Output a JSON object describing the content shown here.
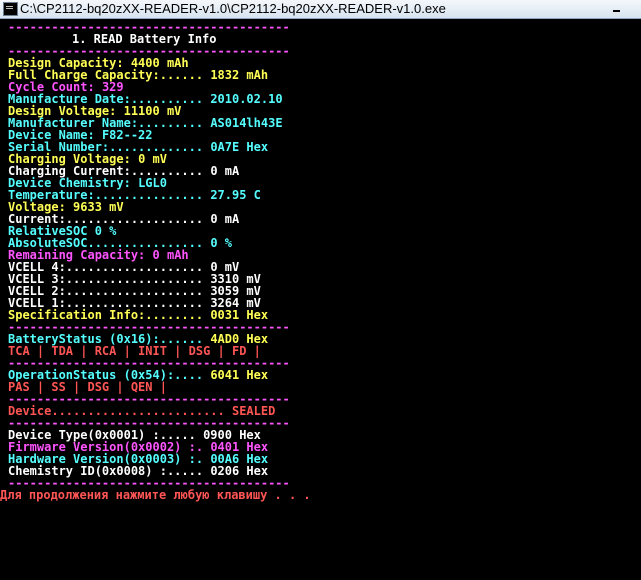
{
  "window": {
    "title": "C:\\CP2112-bq20zXX-READER-v1.0\\CP2112-bq20zXX-READER-v1.0.exe"
  },
  "colors": {
    "white": "#ffffff",
    "yellow": "#ffff55",
    "cyan": "#55ffff",
    "magenta": "#ff55ff",
    "red": "#ff5555",
    "background": "#000000"
  },
  "header": {
    "rule": "---------------------------------------",
    "title": "1. READ Battery Info"
  },
  "fields": [
    {
      "label": "Design Capacity:",
      "value": "4400 mAh",
      "color": "yellow"
    },
    {
      "label": "Full Charge Capacity:......",
      "value": "1832 mAh",
      "color": "yellow"
    },
    {
      "label": "Cycle Count:",
      "value": "329",
      "color": "magenta"
    },
    {
      "label": "Manufacture Date:..........",
      "value": "2010.02.10",
      "color": "cyan"
    },
    {
      "label": "Design Voltage:",
      "value": "11100 mV",
      "color": "yellow"
    },
    {
      "label": "Manufacturer Name:.........",
      "value": "AS014lh43E",
      "color": "cyan"
    },
    {
      "label": "Device Name:",
      "value": "F82--22",
      "color": "cyan"
    },
    {
      "label": "Serial Number:.............",
      "value": "0A7E Hex",
      "color": "cyan"
    },
    {
      "label": "Charging Voltage:",
      "value": "0 mV",
      "color": "yellow"
    },
    {
      "label": "Charging Current:..........",
      "value": "0 mA",
      "color": "white"
    },
    {
      "label": "Device Chemistry:",
      "value": "LGL0",
      "color": "cyan"
    },
    {
      "label": "Temperature:...............",
      "value": "27.95 C",
      "color": "cyan"
    },
    {
      "label": "Voltage:",
      "value": "9633 mV",
      "color": "yellow"
    },
    {
      "label": "Current:...................",
      "value": "0 mA",
      "color": "white"
    },
    {
      "label": "RelativeSOC",
      "value": "0 %",
      "color": "cyan"
    },
    {
      "label": "AbsoluteSOC................",
      "value": "0 %",
      "color": "cyan"
    },
    {
      "label": "Remaining Capacity:",
      "value": "0 mAh",
      "color": "magenta"
    },
    {
      "label": "VCELL 4:...................",
      "value": "0 mV",
      "color": "white"
    },
    {
      "label": "VCELL 3:...................",
      "value": "3310 mV",
      "color": "white"
    },
    {
      "label": "VCELL 2:...................",
      "value": "3059 mV",
      "color": "white"
    },
    {
      "label": "VCELL 1:...................",
      "value": "3264 mV",
      "color": "white"
    },
    {
      "label": "Specification Info:........",
      "value": "0031 Hex",
      "color": "yellow"
    }
  ],
  "battery_status": {
    "label": "BatteryStatus (0x16):......",
    "value": "4AD0 Hex",
    "flags": "TCA | TDA | RCA | INIT | DSG | FD |"
  },
  "operation_status": {
    "label": "OperationStatus (0x54):....",
    "value": "6041 Hex",
    "flags": "PAS | SS | DSG | QEN |"
  },
  "device_status": {
    "text": "Device........................ SEALED"
  },
  "versions": [
    {
      "label": "Device Type(0x0001) :.....",
      "value": "0900 Hex",
      "color": "white"
    },
    {
      "label": "Firmware Version(0x0002) :.",
      "value": "0401 Hex",
      "color": "magenta"
    },
    {
      "label": "Hardware Version(0x0003) :.",
      "value": "00A6 Hex",
      "color": "cyan"
    },
    {
      "label": "Chemistry ID(0x0008) :.....",
      "value": "0206 Hex",
      "color": "white"
    }
  ],
  "prompt": "Для продолжения нажмите любую клавишу . . ."
}
